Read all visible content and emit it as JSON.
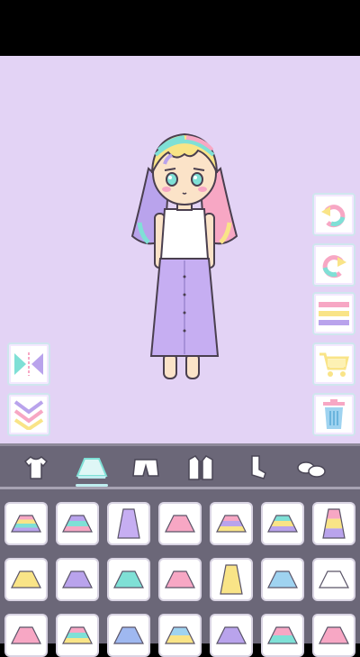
{
  "colors": {
    "stage_background": "#e3d3f5",
    "panel_background": "#6b6778",
    "accent_mint": "#7fe0d6",
    "accent_pink": "#f7a7c4",
    "accent_yellow": "#f9e487",
    "accent_purple": "#b9a3ec"
  },
  "character": {
    "hair": "pastel-rainbow-hair",
    "top": "white-tank-top",
    "bottom": "lavender-long-skirt"
  },
  "side_buttons_right": [
    "undo-icon",
    "redo-icon",
    "menu-icon",
    "shop-cart-icon",
    "trash-icon"
  ],
  "side_buttons_left": [
    "flip-icon",
    "hide-panel-icon"
  ],
  "categories": [
    {
      "name": "tops",
      "icon": "shirt-icon",
      "active": false
    },
    {
      "name": "skirts",
      "icon": "skirt-icon",
      "active": true
    },
    {
      "name": "shorts",
      "icon": "shorts-icon",
      "active": false
    },
    {
      "name": "outerwear",
      "icon": "jacket-icon",
      "active": false
    },
    {
      "name": "socks",
      "icon": "socks-icon",
      "active": false
    },
    {
      "name": "shoes",
      "icon": "shoes-icon",
      "active": false
    }
  ],
  "items": [
    {
      "icon": "tiered-rainbow-skirt-icon",
      "colors": [
        "#f7a7c4",
        "#f9e487",
        "#7fe0d6",
        "#b9a3ec"
      ]
    },
    {
      "icon": "tutu-skirt-icon",
      "colors": [
        "#b9a3ec",
        "#7fe0d6",
        "#f7a7c4"
      ]
    },
    {
      "icon": "long-purple-skirt-icon",
      "colors": [
        "#c6aef2"
      ]
    },
    {
      "icon": "pink-pleated-skirt-icon",
      "colors": [
        "#f7a7c4"
      ]
    },
    {
      "icon": "pastel-stripe-skirt-icon",
      "colors": [
        "#f7a7c4",
        "#b9a3ec",
        "#f9e487"
      ]
    },
    {
      "icon": "ruffle-skirt-icon",
      "colors": [
        "#7fe0d6",
        "#f9e487",
        "#b9a3ec"
      ]
    },
    {
      "icon": "long-rainbow-skirt-icon",
      "colors": [
        "#f7a7c4",
        "#f9e487",
        "#b9a3ec"
      ]
    },
    {
      "icon": "yellow-skirt-icon",
      "colors": [
        "#f9e487"
      ]
    },
    {
      "icon": "purple-skirt-icon",
      "colors": [
        "#b9a3ec"
      ]
    },
    {
      "icon": "mint-skirt-icon",
      "colors": [
        "#7fe0d6"
      ]
    },
    {
      "icon": "pink-skirt-icon",
      "colors": [
        "#f7a7c4"
      ]
    },
    {
      "icon": "long-yellow-skirt-icon",
      "colors": [
        "#f9e487"
      ]
    },
    {
      "icon": "blue-skirt-icon",
      "colors": [
        "#9fd3f0"
      ]
    },
    {
      "icon": "white-skirt-icon",
      "colors": [
        "#ffffff"
      ]
    },
    {
      "icon": "pink-ruffle-skirt-icon",
      "colors": [
        "#f7a7c4"
      ]
    },
    {
      "icon": "rainbow-stripe-skirt-icon",
      "colors": [
        "#f7a7c4",
        "#7fe0d6",
        "#f9e487"
      ]
    },
    {
      "icon": "blue-pleated-skirt-icon",
      "colors": [
        "#9fb8f0"
      ]
    },
    {
      "icon": "diagonal-skirt-icon",
      "colors": [
        "#9fd3f0",
        "#f9e487"
      ]
    },
    {
      "icon": "lilac-skirt-icon",
      "colors": [
        "#b9a3ec"
      ]
    },
    {
      "icon": "stripe-skirt-icon",
      "colors": [
        "#f7a7c4",
        "#7fe0d6"
      ]
    },
    {
      "icon": "coral-skirt-icon",
      "colors": [
        "#f7a7c4"
      ]
    }
  ]
}
